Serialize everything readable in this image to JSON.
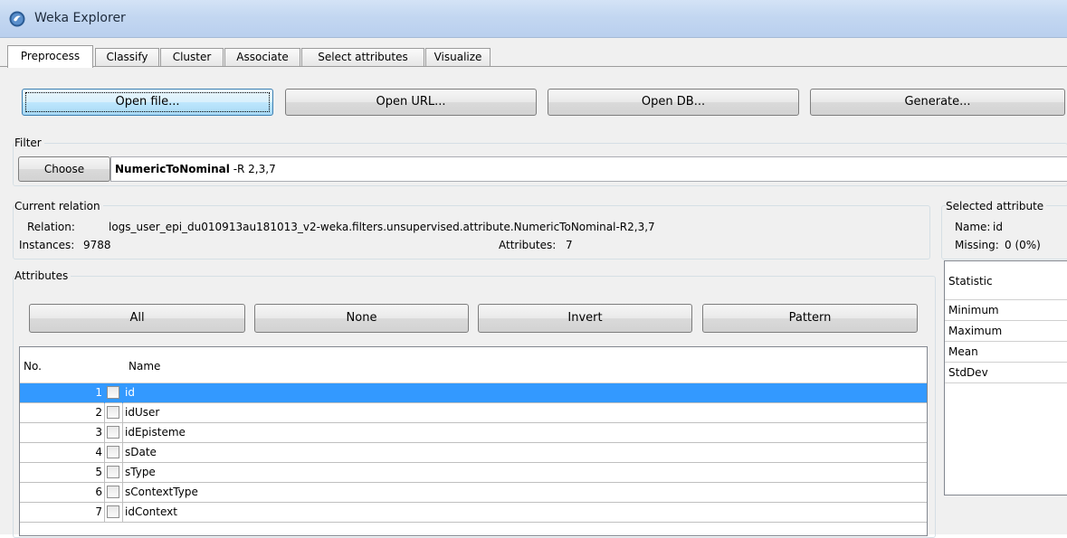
{
  "window": {
    "title": "Weka Explorer",
    "icon": "weka-bird-icon"
  },
  "tabs": [
    {
      "label": "Preprocess",
      "active": true
    },
    {
      "label": "Classify"
    },
    {
      "label": "Cluster"
    },
    {
      "label": "Associate"
    },
    {
      "label": "Select attributes"
    },
    {
      "label": "Visualize"
    }
  ],
  "toolbar": {
    "open_file": "Open file...",
    "open_url": "Open URL...",
    "open_db": "Open DB...",
    "generate": "Generate..."
  },
  "filter": {
    "group_label": "Filter",
    "choose_label": "Choose",
    "name": "NumericToNominal",
    "options": " -R 2,3,7"
  },
  "current_relation": {
    "group_label": "Current relation",
    "relation_label": "Relation:",
    "relation_value": "logs_user_epi_du010913au181013_v2-weka.filters.unsupervised.attribute.NumericToNominal-R2,3,7",
    "instances_label": "Instances:",
    "instances_value": "9788",
    "attributes_label": "Attributes:",
    "attributes_value": "7"
  },
  "attributes": {
    "group_label": "Attributes",
    "buttons": {
      "all": "All",
      "none": "None",
      "invert": "Invert",
      "pattern": "Pattern"
    },
    "columns": {
      "no": "No.",
      "name": "Name"
    },
    "rows": [
      {
        "no": "1",
        "name": "id"
      },
      {
        "no": "2",
        "name": "idUser"
      },
      {
        "no": "3",
        "name": "idEpisteme"
      },
      {
        "no": "4",
        "name": "sDate"
      },
      {
        "no": "5",
        "name": "sType"
      },
      {
        "no": "6",
        "name": "sContextType"
      },
      {
        "no": "7",
        "name": "idContext"
      }
    ]
  },
  "selected_attribute": {
    "group_label": "Selected attribute",
    "name_label": "Name:",
    "name_value": "id",
    "missing_label": "Missing:",
    "missing_value": "0 (0%)",
    "statistic_header": "Statistic",
    "stats": [
      "Minimum",
      "Maximum",
      "Mean",
      "StdDev"
    ]
  },
  "colors": {
    "selection": "#3399ff",
    "title_bar": "#c3d7f1",
    "panel_bg": "#f0f0f0"
  }
}
